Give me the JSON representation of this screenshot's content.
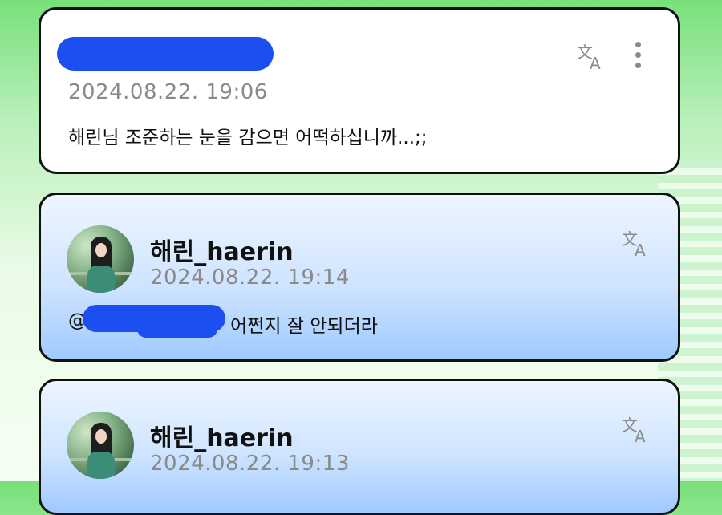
{
  "comments": [
    {
      "author_redacted": true,
      "date": "2024.08.22. 19:06",
      "text": "해린님 조준하는 눈을 감으면 어떡하십니까...;;"
    },
    {
      "author": "해린_haerin",
      "date": "2024.08.22. 19:14",
      "mention_prefix": "@",
      "visible_text_suffix": "어쩐지 잘 안되더라"
    },
    {
      "author": "해린_haerin",
      "date": "2024.08.22. 19:13"
    }
  ],
  "icons": {
    "translate": "translate-icon",
    "more": "more-vertical-icon"
  },
  "colors": {
    "redaction": "#1c4ff0",
    "reply_card_top": "#eef6ff",
    "reply_card_bottom": "#9fcaff",
    "background_green": "#78e07a"
  }
}
